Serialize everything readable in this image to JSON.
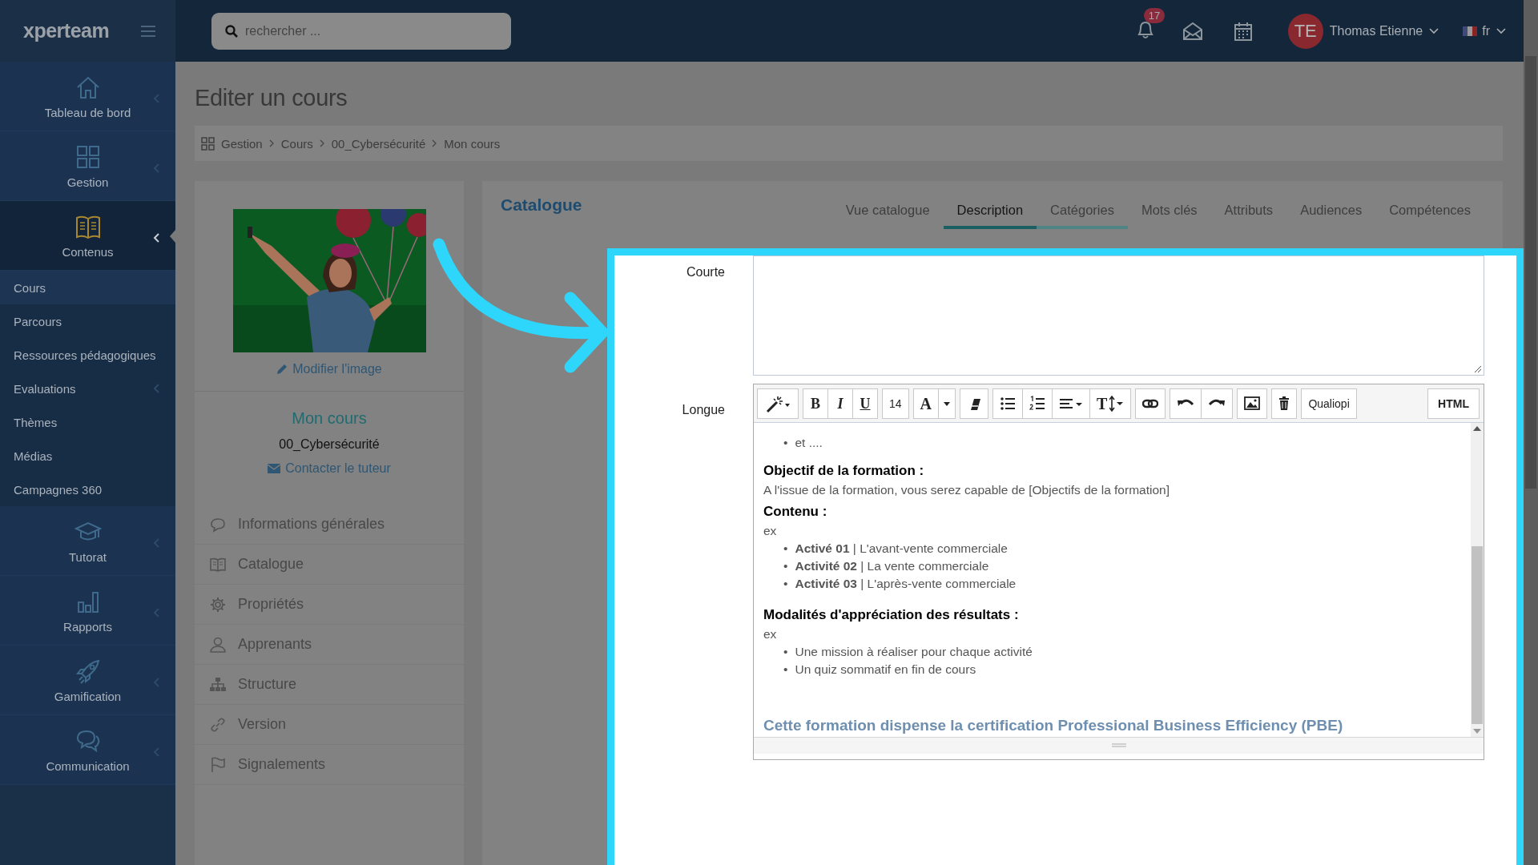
{
  "app": {
    "logo": "xperteam"
  },
  "search": {
    "placeholder": "rechercher ..."
  },
  "notifications": {
    "count": "17"
  },
  "user": {
    "initials": "TE",
    "name": "Thomas Etienne"
  },
  "language": {
    "code": "fr"
  },
  "sidebar": {
    "items": [
      {
        "label": "Tableau de bord",
        "expanded": false
      },
      {
        "label": "Gestion",
        "expanded": false
      },
      {
        "label": "Contenus",
        "expanded": true,
        "children": [
          {
            "label": "Cours",
            "selected": true,
            "expandable": false
          },
          {
            "label": "Parcours",
            "selected": false,
            "expandable": false
          },
          {
            "label": "Ressources pédagogiques",
            "selected": false,
            "expandable": false
          },
          {
            "label": "Evaluations",
            "selected": false,
            "expandable": true
          },
          {
            "label": "Thèmes",
            "selected": false,
            "expandable": false
          },
          {
            "label": "Médias",
            "selected": false,
            "expandable": false
          },
          {
            "label": "Campagnes 360",
            "selected": false,
            "expandable": false
          }
        ]
      },
      {
        "label": "Tutorat",
        "expanded": false
      },
      {
        "label": "Rapports",
        "expanded": false
      },
      {
        "label": "Gamification",
        "expanded": false
      },
      {
        "label": "Communication",
        "expanded": false
      }
    ]
  },
  "page": {
    "title": "Editer un cours",
    "breadcrumb": [
      "Gestion",
      "Cours",
      "00_Cybersécurité",
      "Mon cours"
    ]
  },
  "course_card": {
    "edit_image_link": "Modifier l'image",
    "title": "Mon cours",
    "category": "00_Cybersécurité",
    "contact_link": "Contacter le tuteur",
    "menu": [
      "Informations générales",
      "Catalogue",
      "Propriétés",
      "Apprenants",
      "Structure",
      "Version",
      "Signalements"
    ]
  },
  "panel": {
    "title": "Catalogue",
    "tabs": [
      {
        "label": "Vue catalogue",
        "selected": false,
        "highlighted": false
      },
      {
        "label": "Description",
        "selected": true,
        "highlighted": false
      },
      {
        "label": "Catégories",
        "selected": false,
        "highlighted": true
      },
      {
        "label": "Mots clés",
        "selected": false,
        "highlighted": false
      },
      {
        "label": "Attributs",
        "selected": false,
        "highlighted": false
      },
      {
        "label": "Audiences",
        "selected": false,
        "highlighted": false
      },
      {
        "label": "Compétences",
        "selected": false,
        "highlighted": false
      }
    ],
    "short_label": "Courte",
    "long_label": "Longue",
    "toolbar_groups": [
      [
        {
          "kind": "icon"
        }
      ],
      [
        {
          "kind": "text",
          "label": "B"
        },
        {
          "kind": "text",
          "label": "I"
        },
        {
          "kind": "text",
          "label": "U"
        }
      ],
      [
        {
          "kind": "text",
          "label": "14"
        }
      ],
      [
        {
          "kind": "text",
          "label": "A"
        },
        {
          "kind": "icon"
        }
      ],
      [
        {
          "kind": "icon"
        }
      ],
      [
        {
          "kind": "icon"
        },
        {
          "kind": "icon"
        },
        {
          "kind": "icon"
        },
        {
          "kind": "text-menu",
          "label": "T"
        }
      ],
      [
        {
          "kind": "icon"
        }
      ],
      [
        {
          "kind": "icon"
        },
        {
          "kind": "icon"
        }
      ],
      [
        {
          "kind": "icon"
        }
      ],
      [
        {
          "kind": "icon"
        }
      ],
      [
        {
          "kind": "text",
          "label": "Qualiopi"
        }
      ],
      [
        {
          "kind": "text-end",
          "label": "HTML"
        }
      ]
    ],
    "content": [
      {
        "kind": "list",
        "marker": "•",
        "items": [
          "et ...."
        ]
      },
      {
        "kind": "heading",
        "text": "Objectif de la formation :"
      },
      {
        "kind": "paragraph",
        "text": "A l'issue de la formation, vous serez capable de [Objectifs de la formation]"
      },
      {
        "kind": "heading",
        "text": "Contenu :"
      },
      {
        "kind": "paragraph",
        "text": "ex"
      },
      {
        "kind": "list",
        "marker": "•",
        "items": [
          "**Activé 01** | L'avant-vente commerciale",
          "**Activité 02** | La vente commerciale",
          "**Activité 03** | L'après-vente commerciale"
        ]
      },
      {
        "kind": "heading",
        "text": "Modalités d'appréciation des résultats :"
      },
      {
        "kind": "paragraph",
        "text": "ex"
      },
      {
        "kind": "list",
        "marker": "•",
        "items": [
          "Une mission à réaliser pour chaque activité",
          "Un quiz sommatif en fin de cours"
        ]
      },
      {
        "kind": "note",
        "text": "Cette formation dispense la certification Professional Business Efficiency (PBE)"
      }
    ]
  }
}
